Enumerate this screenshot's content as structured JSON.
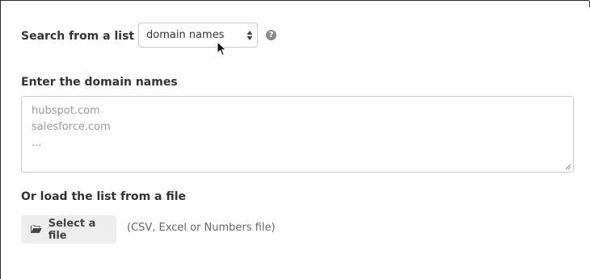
{
  "search": {
    "label": "Search from a list of",
    "select_value": "domain names",
    "help_icon": "question-circle-icon"
  },
  "domains": {
    "label": "Enter the domain names",
    "placeholder_lines": [
      "hubspot.com",
      "salesforce.com",
      "..."
    ]
  },
  "file": {
    "label": "Or load the list from a file",
    "button_label": "Select a file",
    "button_icon": "folder-open-icon",
    "hint": "(CSV, Excel or Numbers file)"
  },
  "colors": {
    "text": "#333333",
    "border": "#c9c9c9",
    "placeholder": "#9a9a9a",
    "button_bg": "#ededed"
  }
}
